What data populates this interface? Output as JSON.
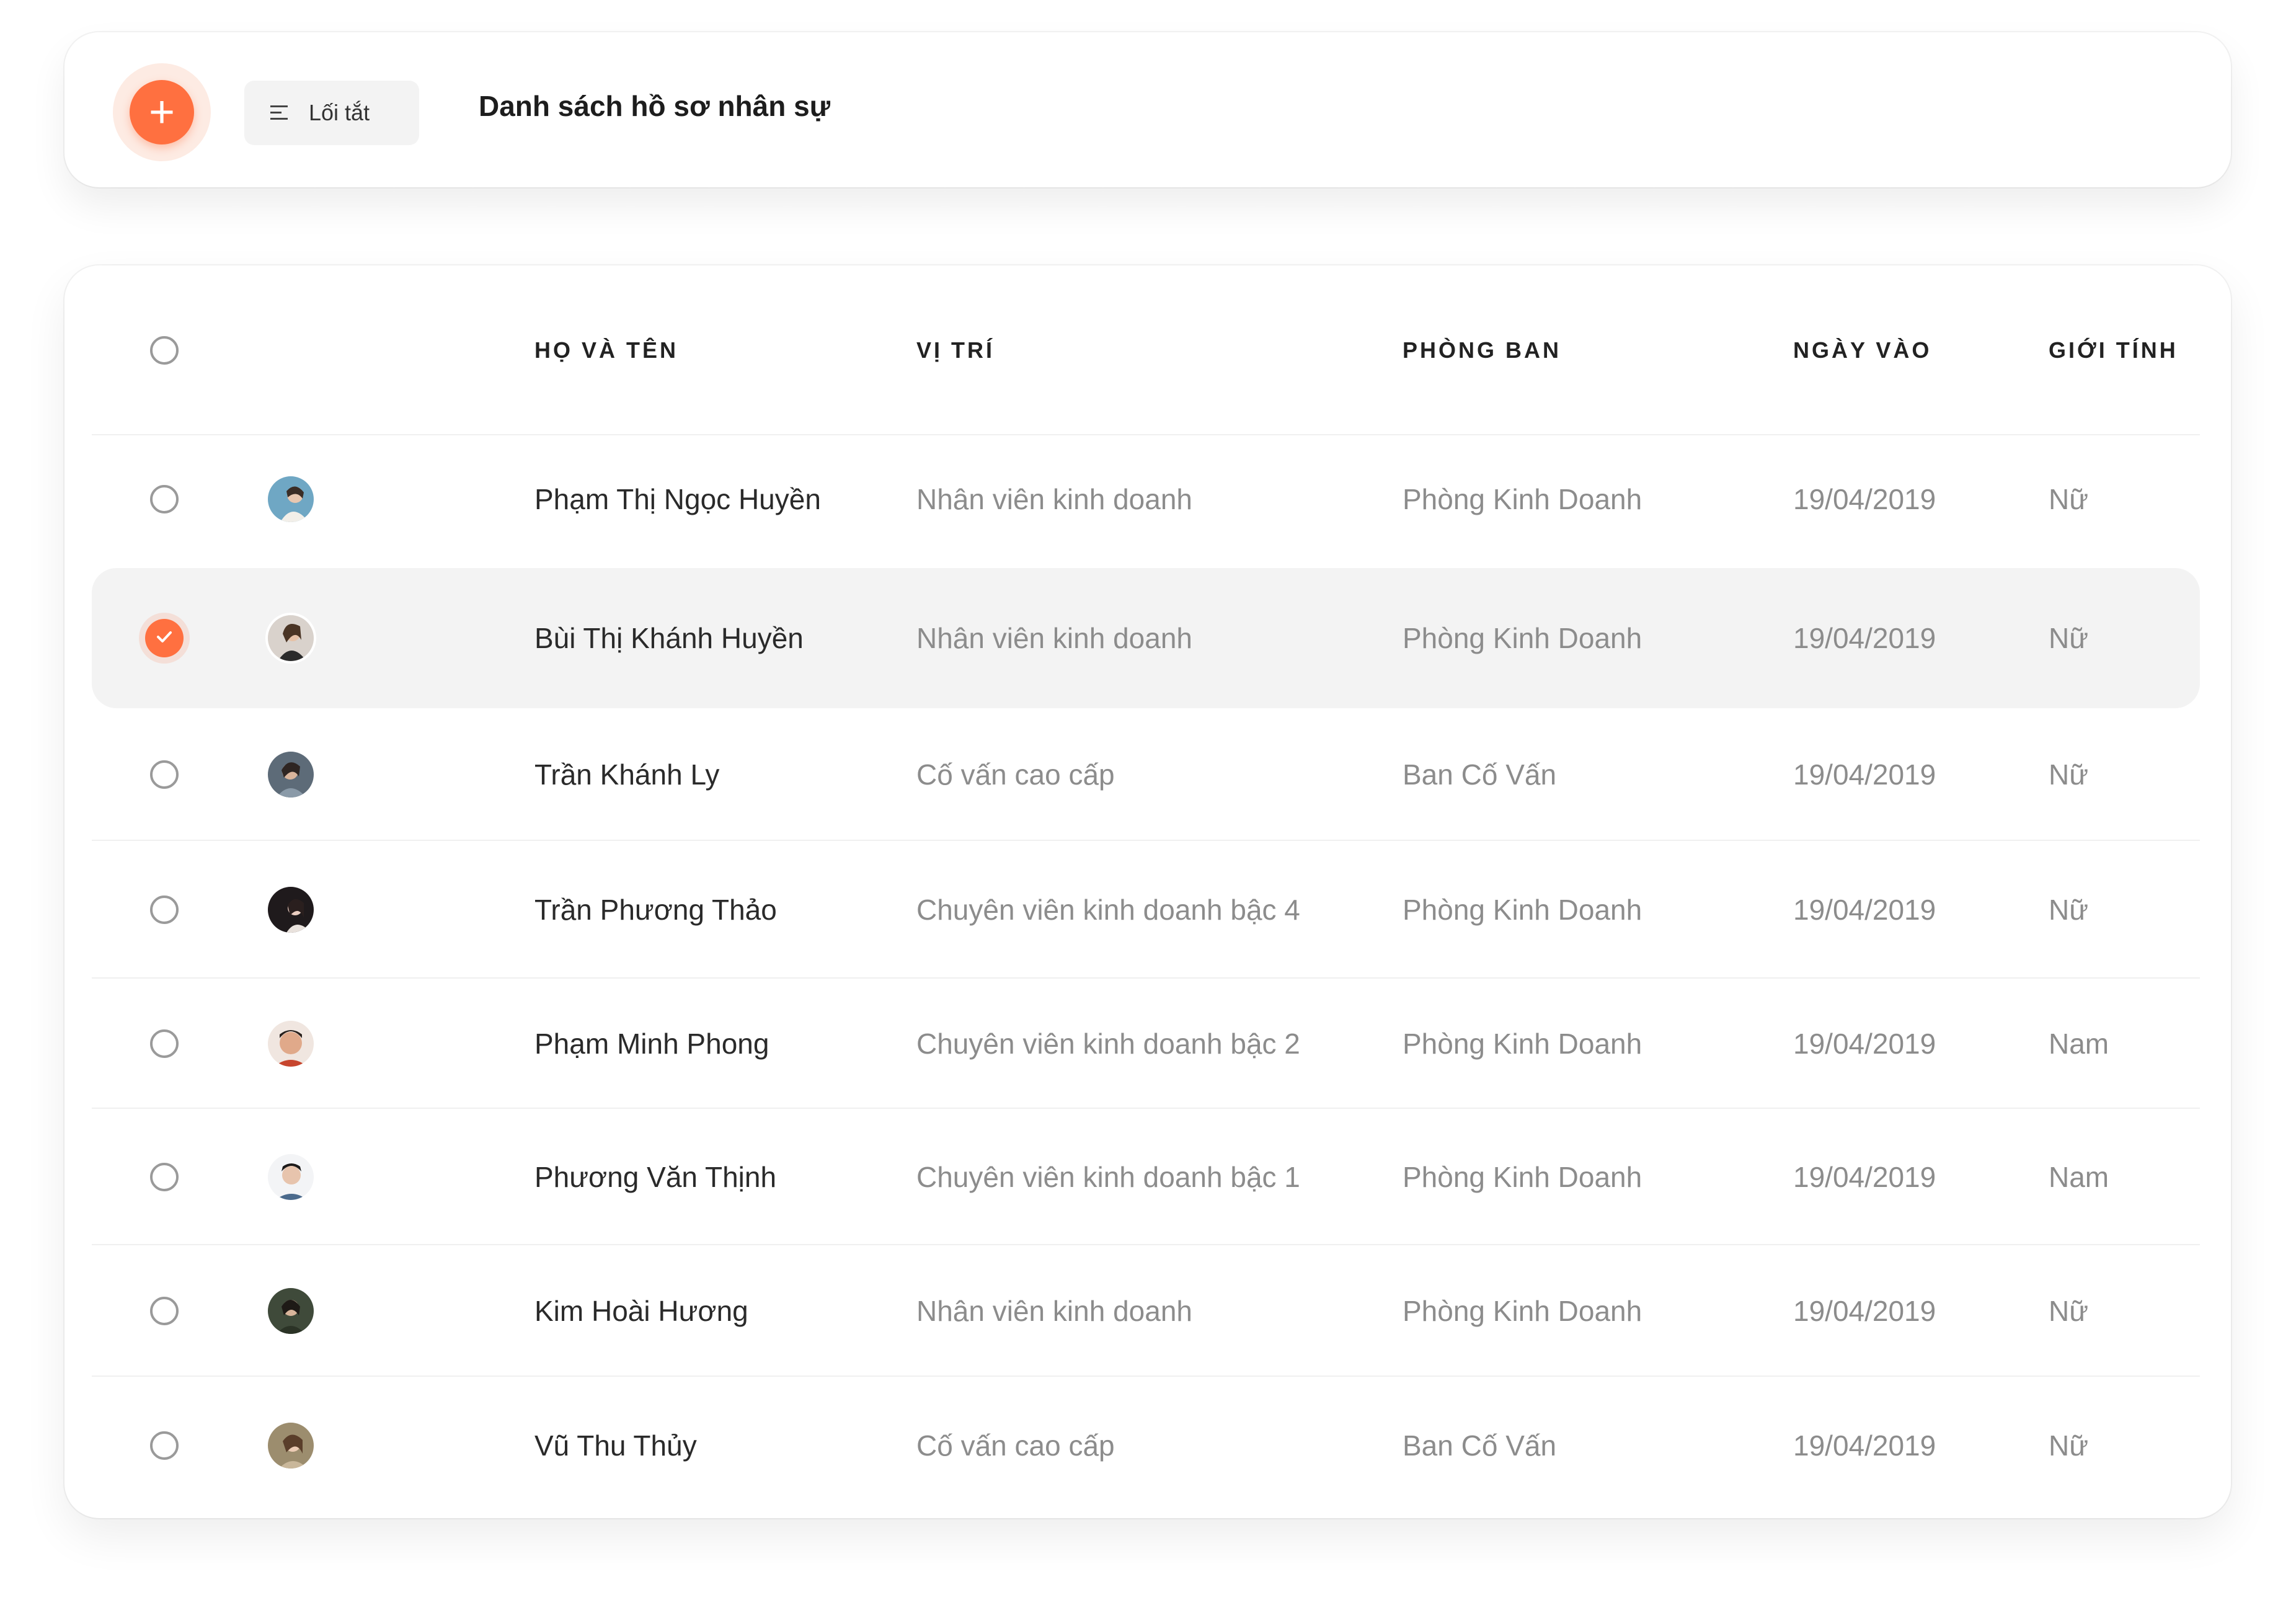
{
  "toolbar": {
    "add_label": "+",
    "shortcut_label": "Lối tắt",
    "title": "Danh sách hồ sơ nhân sự"
  },
  "colors": {
    "accent": "#ff7040",
    "selected_row": "#f3f3f3",
    "muted_text": "#8c8c8c"
  },
  "table": {
    "headers": {
      "name": "HỌ VÀ TÊN",
      "position": "VỊ TRÍ",
      "department": "PHÒNG BAN",
      "start_date": "NGÀY VÀO",
      "gender": "GIỚI TÍNH"
    },
    "rows": [
      {
        "name": "Phạm Thị Ngọc Huyền",
        "position": "Nhân viên kinh doanh",
        "department": "Phòng Kinh Doanh",
        "start_date": "19/04/2019",
        "gender": "Nữ",
        "checked": false
      },
      {
        "name": "Bùi Thị Khánh Huyền",
        "position": "Nhân viên kinh doanh",
        "department": "Phòng Kinh Doanh",
        "start_date": "19/04/2019",
        "gender": "Nữ",
        "checked": true
      },
      {
        "name": "Trần Khánh Ly",
        "position": "Cố vấn cao cấp",
        "department": "Ban Cố Vấn",
        "start_date": "19/04/2019",
        "gender": "Nữ",
        "checked": false
      },
      {
        "name": "Trần Phương Thảo",
        "position": "Chuyên viên kinh doanh bậc 4",
        "department": "Phòng Kinh Doanh",
        "start_date": "19/04/2019",
        "gender": "Nữ",
        "checked": false
      },
      {
        "name": "Phạm Minh Phong",
        "position": "Chuyên viên kinh doanh bậc 2",
        "department": "Phòng Kinh Doanh",
        "start_date": "19/04/2019",
        "gender": "Nam",
        "checked": false
      },
      {
        "name": "Phương Văn Thịnh",
        "position": "Chuyên viên kinh doanh bậc 1",
        "department": "Phòng Kinh Doanh",
        "start_date": "19/04/2019",
        "gender": "Nam",
        "checked": false
      },
      {
        "name": "Kim Hoài Hương",
        "position": "Nhân viên kinh doanh",
        "department": "Phòng Kinh Doanh",
        "start_date": "19/04/2019",
        "gender": "Nữ",
        "checked": false
      },
      {
        "name": "Vũ Thu Thủy",
        "position": "Cố vấn cao cấp",
        "department": "Ban Cố Vấn",
        "start_date": "19/04/2019",
        "gender": "Nữ",
        "checked": false
      }
    ]
  }
}
